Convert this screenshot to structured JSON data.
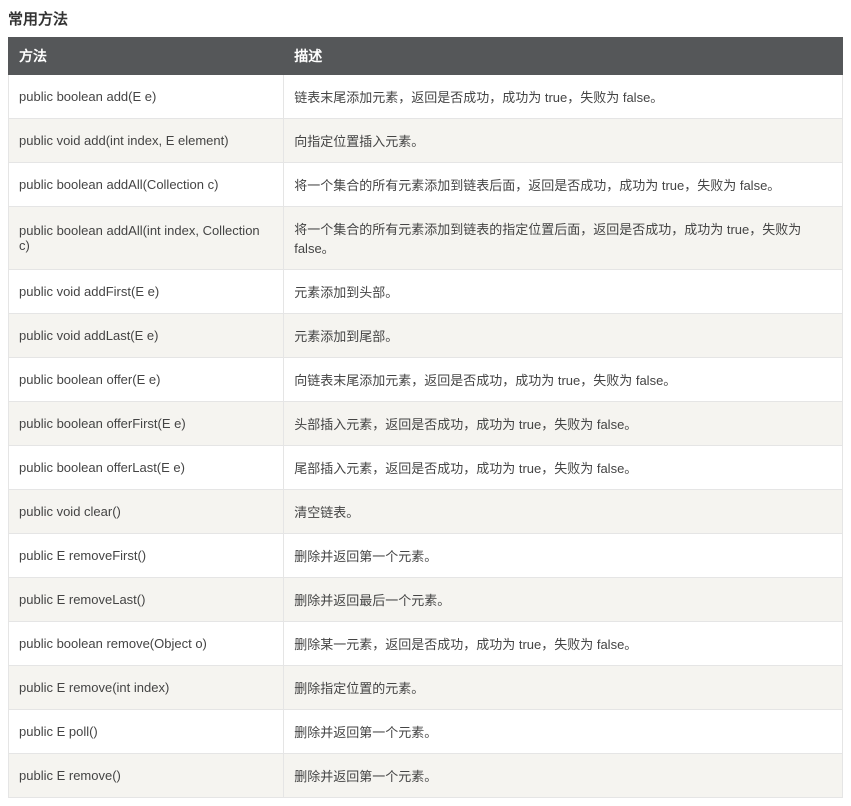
{
  "title": "常用方法",
  "table": {
    "headers": {
      "method": "方法",
      "description": "描述"
    },
    "rows": [
      {
        "method": "public boolean add(E e)",
        "description": "链表末尾添加元素，返回是否成功，成功为 true，失败为 false。"
      },
      {
        "method": "public void add(int index, E element)",
        "description": "向指定位置插入元素。"
      },
      {
        "method": "public boolean addAll(Collection c)",
        "description": "将一个集合的所有元素添加到链表后面，返回是否成功，成功为 true，失败为 false。"
      },
      {
        "method": "public boolean addAll(int index, Collection c)",
        "description": "将一个集合的所有元素添加到链表的指定位置后面，返回是否成功，成功为 true，失败为 false。"
      },
      {
        "method": "public void addFirst(E e)",
        "description": "元素添加到头部。"
      },
      {
        "method": "public void addLast(E e)",
        "description": "元素添加到尾部。"
      },
      {
        "method": "public boolean offer(E e)",
        "description": "向链表末尾添加元素，返回是否成功，成功为 true，失败为 false。"
      },
      {
        "method": "public boolean offerFirst(E e)",
        "description": "头部插入元素，返回是否成功，成功为 true，失败为 false。"
      },
      {
        "method": "public boolean offerLast(E e)",
        "description": "尾部插入元素，返回是否成功，成功为 true，失败为 false。"
      },
      {
        "method": "public void clear()",
        "description": "清空链表。"
      },
      {
        "method": "public E removeFirst()",
        "description": "删除并返回第一个元素。"
      },
      {
        "method": "public E removeLast()",
        "description": "删除并返回最后一个元素。"
      },
      {
        "method": "public boolean remove(Object o)",
        "description": "删除某一元素，返回是否成功，成功为 true，失败为 false。"
      },
      {
        "method": "public E remove(int index)",
        "description": "删除指定位置的元素。"
      },
      {
        "method": "public E poll()",
        "description": "删除并返回第一个元素。"
      },
      {
        "method": "public E remove()",
        "description": "删除并返回第一个元素。"
      }
    ]
  }
}
